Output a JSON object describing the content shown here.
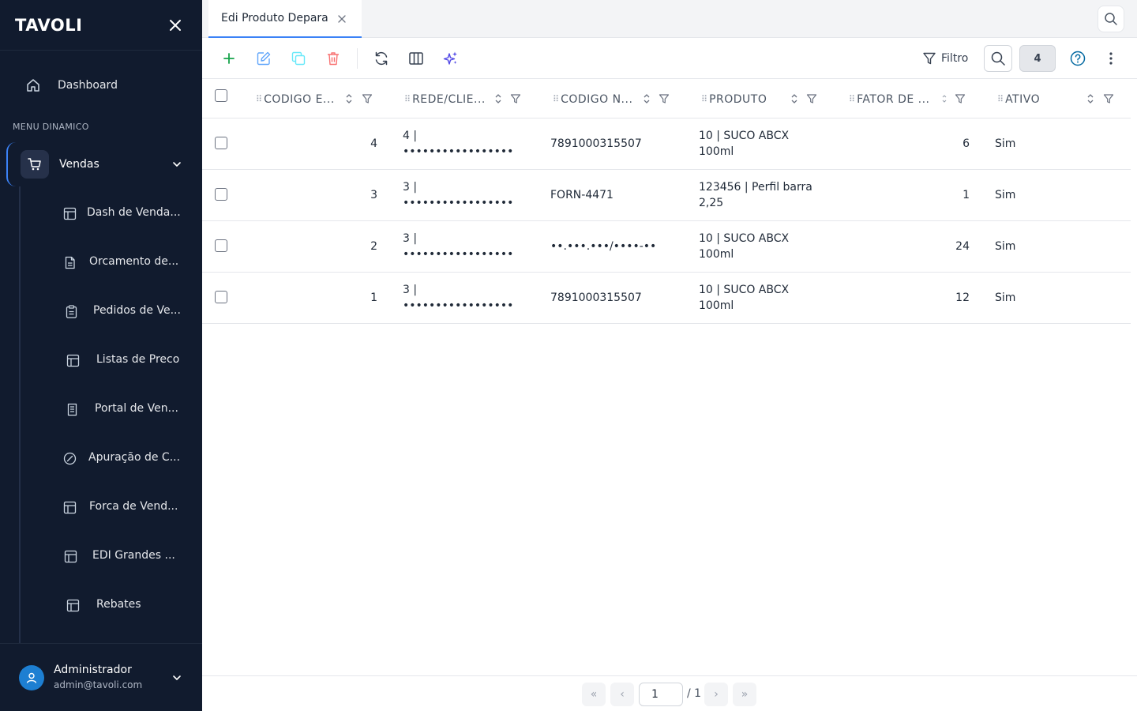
{
  "app": {
    "logo": "TAVOLI"
  },
  "sidebar": {
    "dashboard_label": "Dashboard",
    "section_label": "MENU DINAMICO",
    "active_group": "Vendas",
    "sub_items": [
      {
        "label": "Dash de Venda...",
        "icon": "layout-icon"
      },
      {
        "label": "Orcamento de...",
        "icon": "document-icon"
      },
      {
        "label": "Pedidos de Ve...",
        "icon": "clipboard-icon"
      },
      {
        "label": "Listas de Preco",
        "icon": "layout-icon"
      },
      {
        "label": "Portal de Ven...",
        "icon": "document-icon"
      },
      {
        "label": "Apuração de C...",
        "icon": "gauge-icon"
      },
      {
        "label": "Forca de Vend...",
        "icon": "layout-icon"
      },
      {
        "label": "EDI Grandes ...",
        "icon": "layout-icon"
      },
      {
        "label": "Rebates",
        "icon": "layout-icon"
      }
    ],
    "user": {
      "name": "Administrador",
      "email": "admin@tavoli.com"
    }
  },
  "tabs": [
    {
      "label": "Edi Produto Depara",
      "active": true
    }
  ],
  "toolbar": {
    "filter_label": "Filtro",
    "record_count": "4"
  },
  "table": {
    "columns": [
      "CODIGO E...",
      "REDE/CLIE...",
      "CODIGO N...",
      "PRODUTO",
      "FATOR DE ...",
      "ATIVO"
    ],
    "rows": [
      {
        "codigo": "4",
        "rede_1": "4 |",
        "rede_2": "•••••••••••••••••",
        "codigo_n": "7891000315507",
        "produto_1": "10 | SUCO ABCX",
        "produto_2": "100ml",
        "fator": "6",
        "ativo": "Sim"
      },
      {
        "codigo": "3",
        "rede_1": "3 |",
        "rede_2": "•••••••••••••••••",
        "codigo_n": "FORN-4471",
        "produto_1": "123456 | Perfil barra",
        "produto_2": "2,25",
        "fator": "1",
        "ativo": "Sim"
      },
      {
        "codigo": "2",
        "rede_1": "3 |",
        "rede_2": "•••••••••••••••••",
        "codigo_n": "••.•••.•••/••••-••",
        "produto_1": "10 | SUCO ABCX",
        "produto_2": "100ml",
        "fator": "24",
        "ativo": "Sim"
      },
      {
        "codigo": "1",
        "rede_1": "3 |",
        "rede_2": "•••••••••••••••••",
        "codigo_n": "7891000315507",
        "produto_1": "10 | SUCO ABCX",
        "produto_2": "100ml",
        "fator": "12",
        "ativo": "Sim"
      }
    ]
  },
  "pagination": {
    "first": "«",
    "prev": "‹",
    "current_page": "1",
    "total": "/ 1",
    "next": "›",
    "last": "»"
  },
  "colors": {
    "sidebar_bg": "#111b2e",
    "accent": "#3b82f6",
    "add": "#16a34a",
    "edit": "#60a5fa",
    "copy": "#22d3ee",
    "delete": "#ef4444",
    "ai": "#4f46e5",
    "help": "#0369a1"
  }
}
